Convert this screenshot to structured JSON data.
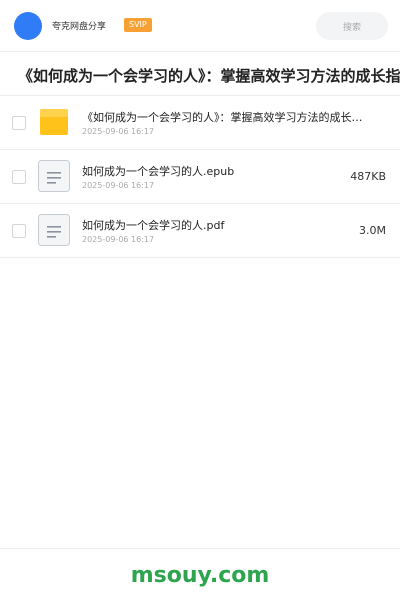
{
  "header": {
    "user_name": "夸克网盘分享",
    "badge": "SVIP",
    "search_label": "搜索"
  },
  "share": {
    "title": "《如何成为一个会学习的人》：掌握高效学习方法的成长指南"
  },
  "files": [
    {
      "name": "《如何成为一个会学习的人》：掌握高效学习方法的成长指南",
      "date": "2025-09-06 16:17",
      "size": "",
      "type": "folder-icon"
    },
    {
      "name": "如何成为一个会学习的人.epub",
      "date": "2025-09-06 16:17",
      "size": "487KB",
      "type": "document-icon"
    },
    {
      "name": "如何成为一个会学习的人.pdf",
      "date": "2025-09-06 16:17",
      "size": "3.0M",
      "type": "document-icon"
    }
  ],
  "footer": {
    "watermark": "msouy.com"
  },
  "colors": {
    "avatar": "#2f7cf6",
    "badge": "#f7a033",
    "folder": "#ffc21a",
    "watermark": "#2da44e"
  }
}
